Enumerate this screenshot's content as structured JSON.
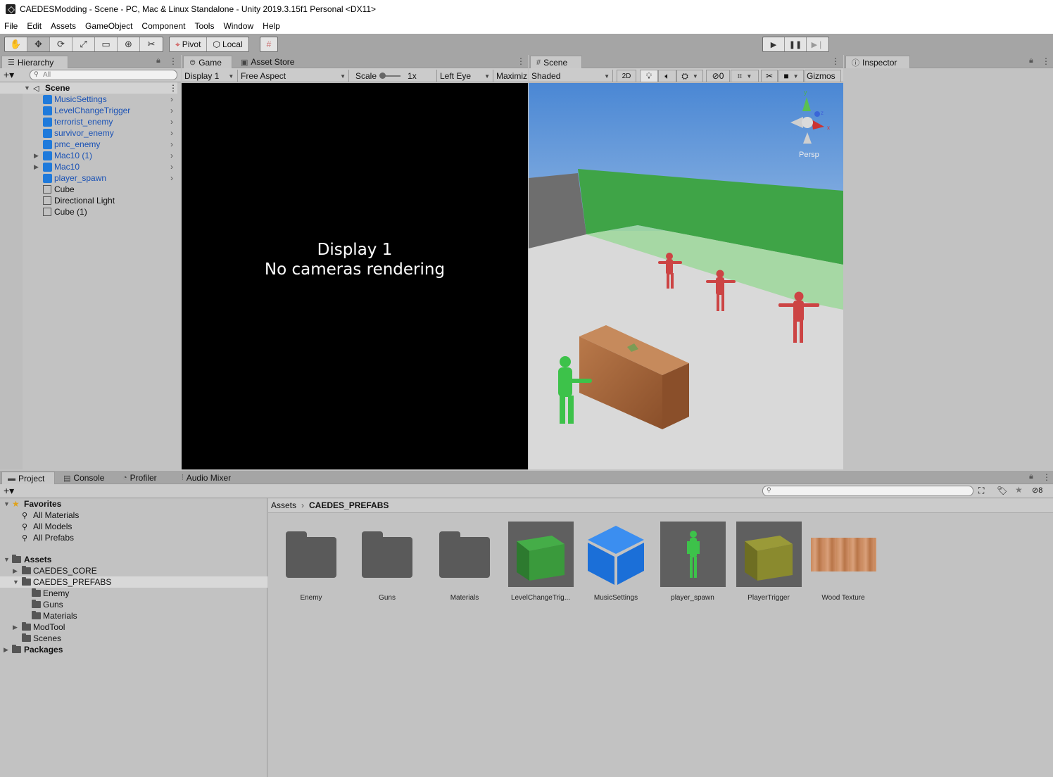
{
  "window": {
    "title": "CAEDESModding - Scene - PC, Mac & Linux Standalone - Unity 2019.3.15f1 Personal <DX11>"
  },
  "menu": [
    "File",
    "Edit",
    "Assets",
    "GameObject",
    "Component",
    "Tools",
    "Window",
    "Help"
  ],
  "toolbar": {
    "tools": [
      "hand-icon",
      "move-icon",
      "rotate-icon",
      "scale-icon",
      "rect-icon",
      "transform-icon",
      "custom-tool-icon"
    ],
    "pivot": "Pivot",
    "local": "Local",
    "play": [
      "play-icon",
      "pause-icon",
      "step-icon"
    ]
  },
  "hierarchy": {
    "tab": "Hierarchy",
    "search_placeholder": "All",
    "scene": "Scene",
    "items": [
      {
        "label": "MusicSettings",
        "prefab": true
      },
      {
        "label": "LevelChangeTrigger",
        "prefab": true
      },
      {
        "label": "terrorist_enemy",
        "prefab": true
      },
      {
        "label": "survivor_enemy",
        "prefab": true
      },
      {
        "label": "pmc_enemy",
        "prefab": true
      },
      {
        "label": "Mac10 (1)",
        "prefab": true
      },
      {
        "label": "Mac10",
        "prefab": true
      },
      {
        "label": "player_spawn",
        "prefab": true
      },
      {
        "label": "Cube",
        "prefab": false
      },
      {
        "label": "Directional Light",
        "prefab": false
      },
      {
        "label": "Cube (1)",
        "prefab": false
      }
    ]
  },
  "game": {
    "tabs": [
      "Game",
      "Asset Store"
    ],
    "display": "Display 1",
    "aspect": "Free Aspect",
    "scale_label": "Scale",
    "scale_value": "1x",
    "eye": "Left Eye",
    "maximize": "Maximiz",
    "message_line1": "Display 1",
    "message_line2": "No cameras rendering"
  },
  "scene": {
    "tab": "Scene",
    "shading": "Shaded",
    "mode2d": "2D",
    "hidden_count": "0",
    "gizmos": "Gizmos",
    "persp": "Persp",
    "axis_y": "y",
    "axis_x": "x",
    "axis_z": "z"
  },
  "inspector": {
    "tab": "Inspector"
  },
  "project": {
    "tabs": [
      "Project",
      "Console",
      "Profiler",
      "Audio Mixer"
    ],
    "hidden_count": "8",
    "favorites": {
      "label": "Favorites",
      "items": [
        "All Materials",
        "All Models",
        "All Prefabs"
      ]
    },
    "assets_label": "Assets",
    "tree": [
      {
        "label": "CAEDES_CORE",
        "indent": 1,
        "arrow": "right"
      },
      {
        "label": "CAEDES_PREFABS",
        "indent": 1,
        "arrow": "down",
        "selected": true
      },
      {
        "label": "Enemy",
        "indent": 2,
        "arrow": ""
      },
      {
        "label": "Guns",
        "indent": 2,
        "arrow": ""
      },
      {
        "label": "Materials",
        "indent": 2,
        "arrow": ""
      },
      {
        "label": "ModTool",
        "indent": 1,
        "arrow": "right"
      },
      {
        "label": "Scenes",
        "indent": 1,
        "arrow": ""
      }
    ],
    "packages_label": "Packages",
    "breadcrumb": [
      "Assets",
      "CAEDES_PREFABS"
    ],
    "assets": [
      {
        "label": "Enemy",
        "kind": "folder"
      },
      {
        "label": "Guns",
        "kind": "folder"
      },
      {
        "label": "Materials",
        "kind": "folder"
      },
      {
        "label": "LevelChangeTrig...",
        "kind": "green-cube"
      },
      {
        "label": "MusicSettings",
        "kind": "blue-prefab"
      },
      {
        "label": "player_spawn",
        "kind": "green-figure"
      },
      {
        "label": "PlayerTrigger",
        "kind": "olive-cube"
      },
      {
        "label": "Wood Texture",
        "kind": "wood"
      }
    ]
  },
  "colors": {
    "prefab_text": "#1a52b5",
    "prefab_icon": "#1f7adb",
    "toolbar_bg": "#a5a5a5",
    "panel_bg": "#c2c2c2"
  }
}
